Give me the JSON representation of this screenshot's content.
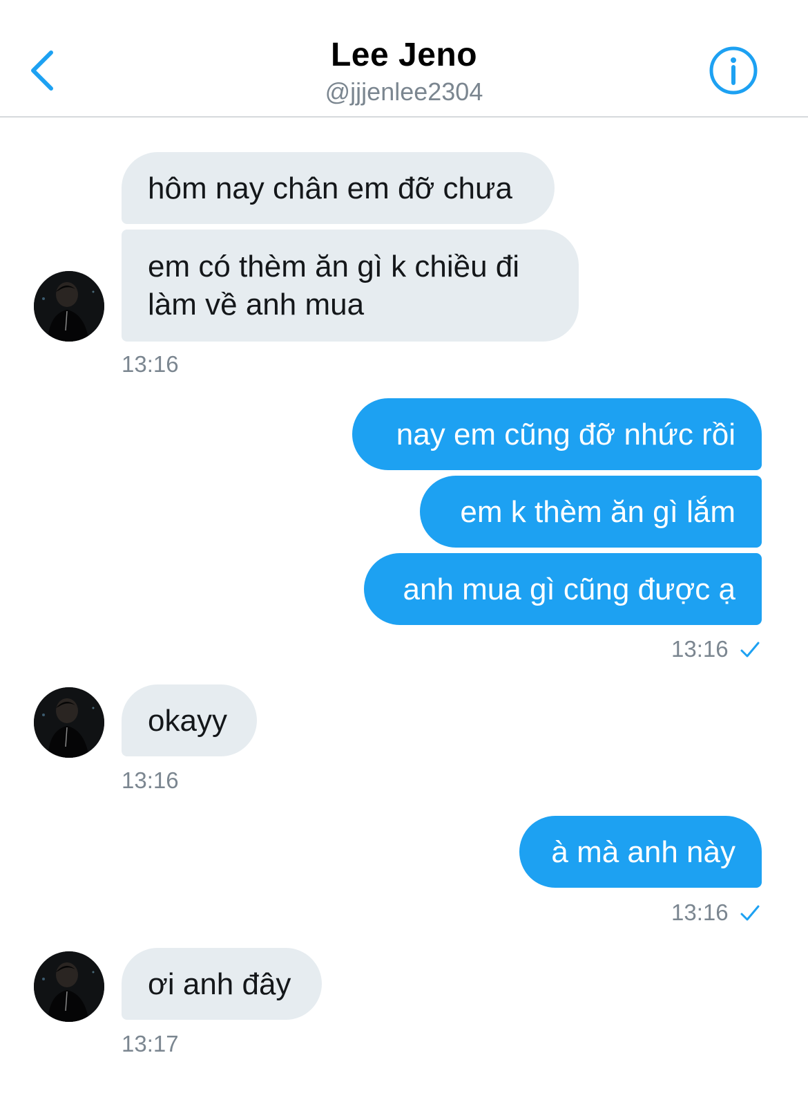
{
  "header": {
    "title": "Lee Jeno",
    "handle": "@jjjenlee2304"
  },
  "colors": {
    "accent": "#1da1f2",
    "incoming_bubble": "#e6ecf0",
    "meta_text": "#7b8690"
  },
  "messages": {
    "m1": "hôm nay chân em đỡ chưa",
    "m2_line1": "em có thèm ăn gì k chiều đi",
    "m2_line2": "làm về anh mua",
    "t1": "13:16",
    "m3": "nay em cũng đỡ nhức rồi",
    "m4": "em k thèm ăn gì lắm",
    "m5": "anh mua gì cũng được ạ",
    "t2": "13:16",
    "m6": "okayy",
    "t3": "13:16",
    "m7": "à mà anh này",
    "t4": "13:16",
    "m8": "ơi anh đây",
    "t5": "13:17"
  },
  "icons": {
    "back": "chevron-left-icon",
    "info": "info-icon",
    "read_receipt": "checkmark-icon"
  }
}
